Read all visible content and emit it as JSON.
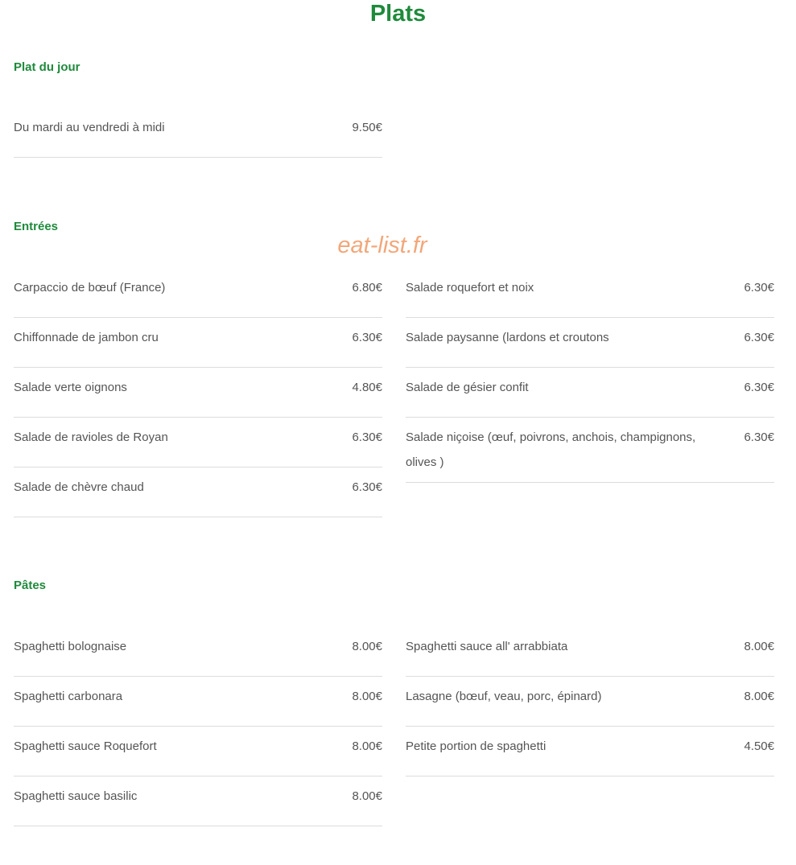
{
  "page": {
    "title": "Plats",
    "watermark": "eat-list.fr"
  },
  "sections": {
    "plat_du_jour": {
      "heading": "Plat du jour",
      "left": [
        {
          "name": "Du mardi au vendredi à midi",
          "price": "9.50€"
        }
      ]
    },
    "entrees": {
      "heading": "Entrées",
      "left": [
        {
          "name": "Carpaccio de bœuf (France)",
          "price": "6.80€"
        },
        {
          "name": "Chiffonnade de jambon cru",
          "price": "6.30€"
        },
        {
          "name": "Salade verte oignons",
          "price": "4.80€"
        },
        {
          "name": "Salade de ravioles de Royan",
          "price": "6.30€"
        },
        {
          "name": "Salade de chèvre chaud",
          "price": "6.30€"
        }
      ],
      "right": [
        {
          "name": "Salade roquefort et noix",
          "price": "6.30€"
        },
        {
          "name": "Salade paysanne (lardons et croutons",
          "price": "6.30€"
        },
        {
          "name": "Salade de gésier confit",
          "price": "6.30€"
        },
        {
          "name": "Salade niçoise (œuf, poivrons, anchois, champignons, olives )",
          "price": "6.30€"
        }
      ]
    },
    "pates": {
      "heading": "Pâtes",
      "left": [
        {
          "name": "Spaghetti bolognaise",
          "price": "8.00€"
        },
        {
          "name": "Spaghetti carbonara",
          "price": "8.00€"
        },
        {
          "name": "Spaghetti sauce Roquefort",
          "price": "8.00€"
        },
        {
          "name": "Spaghetti sauce basilic",
          "price": "8.00€"
        }
      ],
      "right": [
        {
          "name": "Spaghetti sauce all' arrabbiata",
          "price": "8.00€"
        },
        {
          "name": "Lasagne (bœuf, veau, porc, épinard)",
          "price": "8.00€"
        },
        {
          "name": "Petite portion de spaghetti",
          "price": "4.50€"
        }
      ]
    }
  }
}
